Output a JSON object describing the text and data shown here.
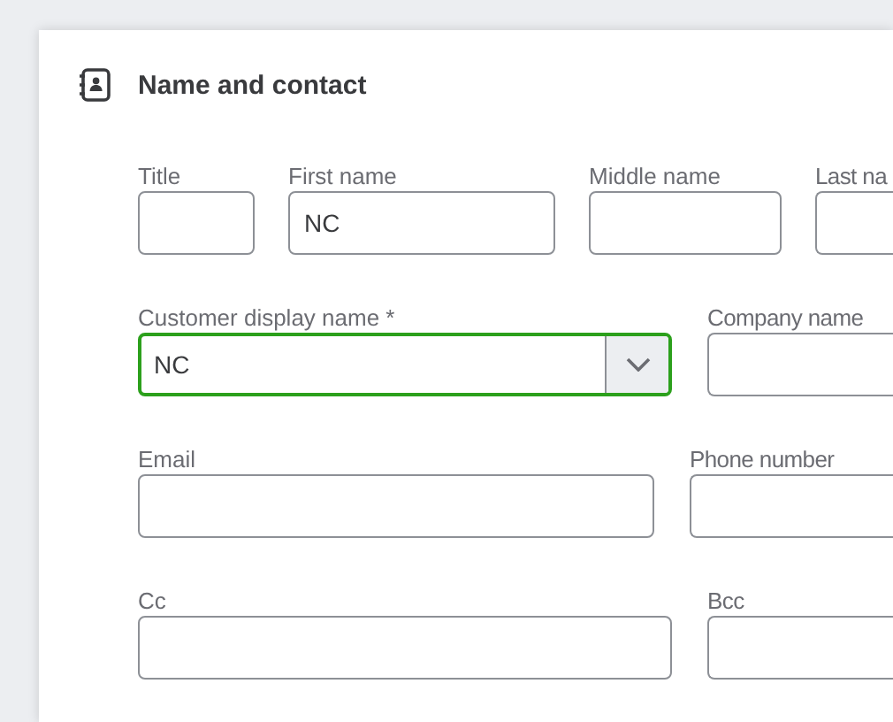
{
  "section": {
    "title": "Name and contact"
  },
  "rows": [
    {
      "fields": [
        {
          "label": "Title",
          "kind": "text",
          "focused": false,
          "cut": false
        },
        {
          "label": "First name",
          "value": "NC",
          "kind": "text",
          "focused": false,
          "cut": false
        },
        {
          "label": "Middle name",
          "kind": "text",
          "focused": false,
          "cut": false
        },
        {
          "label": "Last na",
          "kind": "text",
          "focused": false,
          "cut": true
        }
      ]
    },
    {
      "fields": [
        {
          "label": "Customer display name *",
          "value": "NC",
          "kind": "select",
          "focused": true,
          "cut": false
        },
        {
          "label": "Company name",
          "kind": "text",
          "focused": false,
          "cut": true
        }
      ]
    },
    {
      "fields": [
        {
          "label": "Email",
          "kind": "text",
          "focused": false,
          "cut": false
        },
        {
          "label": "Phone number",
          "kind": "text",
          "focused": false,
          "cut": true
        }
      ]
    },
    {
      "fields": [
        {
          "label": "Cc",
          "kind": "text",
          "focused": false,
          "cut": false
        },
        {
          "label": "Bcc",
          "kind": "text",
          "focused": false,
          "cut": true
        }
      ]
    }
  ]
}
